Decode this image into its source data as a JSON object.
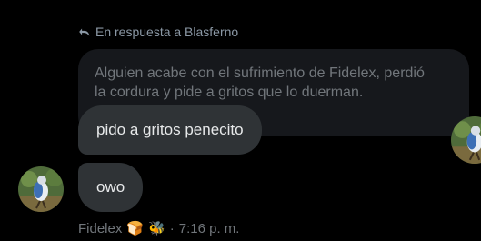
{
  "reply": {
    "label": "En respuesta a Blasferno",
    "icon": "reply-arrow-icon"
  },
  "quoted": {
    "line1": "Alguien acabe con el sufrimiento de Fidelex, perdió",
    "line2": "la cordura y pide a gritos que lo duerman."
  },
  "messages": [
    {
      "text": "pido a gritos penecito"
    },
    {
      "text": "owo"
    }
  ],
  "footer": {
    "name": "Fidelex",
    "emoji_bread": "🍞",
    "emoji_bee": "🐝",
    "separator": "·",
    "time": "7:16 p. m."
  },
  "colors": {
    "background": "#000000",
    "bubble": "#2f3336",
    "quoted_bg": "#16181c",
    "muted_text": "#71767b",
    "text": "#e7e9ea"
  }
}
